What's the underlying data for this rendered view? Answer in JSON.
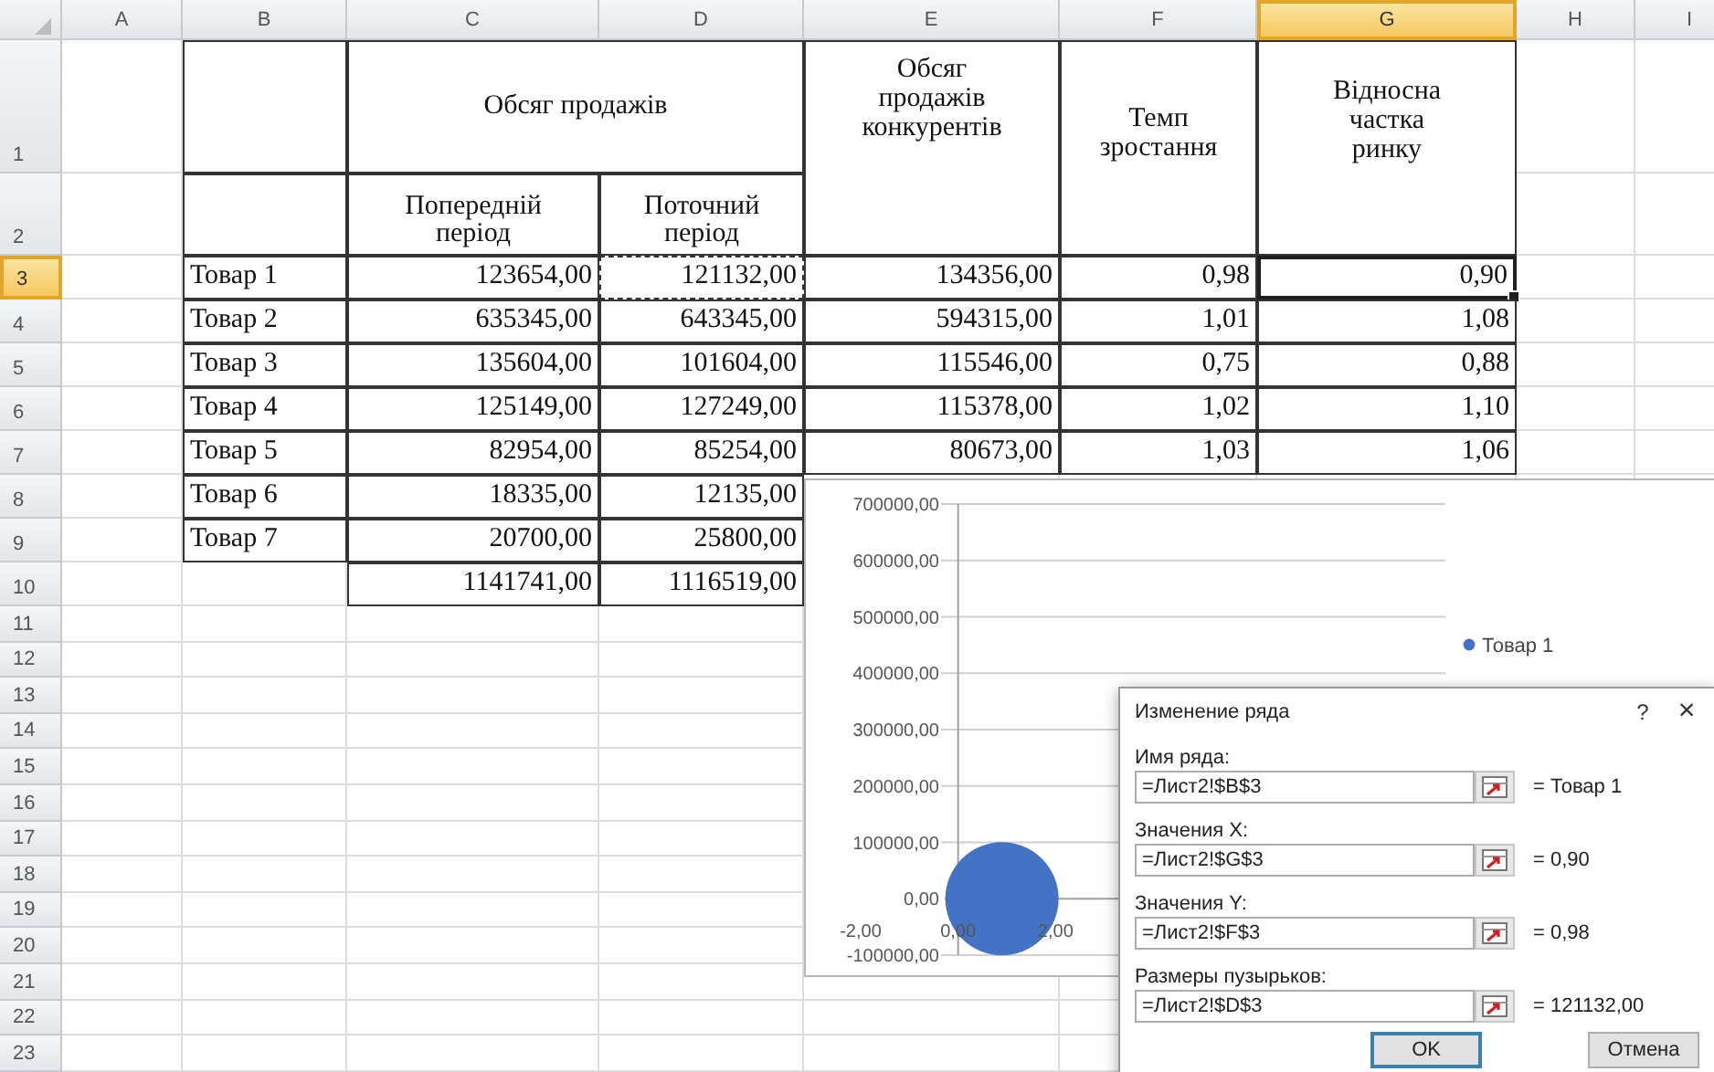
{
  "columns": [
    {
      "label": "A",
      "selected": false
    },
    {
      "label": "B",
      "selected": false
    },
    {
      "label": "C",
      "selected": false
    },
    {
      "label": "D",
      "selected": false
    },
    {
      "label": "E",
      "selected": false
    },
    {
      "label": "F",
      "selected": false
    },
    {
      "label": "G",
      "selected": true
    },
    {
      "label": "H",
      "selected": false
    },
    {
      "label": "I",
      "selected": false
    }
  ],
  "rows": [
    {
      "label": "1",
      "selected": false
    },
    {
      "label": "2",
      "selected": false
    },
    {
      "label": "3",
      "selected": true
    },
    {
      "label": "4",
      "selected": false
    },
    {
      "label": "5",
      "selected": false
    },
    {
      "label": "6",
      "selected": false
    },
    {
      "label": "7",
      "selected": false
    },
    {
      "label": "8",
      "selected": false
    },
    {
      "label": "9",
      "selected": false
    },
    {
      "label": "10",
      "selected": false
    },
    {
      "label": "11",
      "selected": false
    },
    {
      "label": "12",
      "selected": false
    },
    {
      "label": "13",
      "selected": false
    },
    {
      "label": "14",
      "selected": false
    },
    {
      "label": "15",
      "selected": false
    },
    {
      "label": "16",
      "selected": false
    },
    {
      "label": "17",
      "selected": false
    },
    {
      "label": "18",
      "selected": false
    },
    {
      "label": "19",
      "selected": false
    },
    {
      "label": "20",
      "selected": false
    },
    {
      "label": "21",
      "selected": false
    },
    {
      "label": "22",
      "selected": false
    },
    {
      "label": "23",
      "selected": false
    }
  ],
  "table": {
    "sales_header": "Обсяг продажів",
    "previous_header": "Попередній період",
    "current_header": "Поточний період",
    "competitors_header": "Обсяг продажів конкурентів",
    "growth_header": "Темп зростання",
    "share_header": "Відносна частка ринку",
    "products": [
      {
        "name": "Товар 1",
        "previous": "123654,00",
        "current": "121132,00",
        "competitors": "134356,00",
        "growth": "0,98",
        "share": "0,90",
        "current_copied": true,
        "share_selected": true
      },
      {
        "name": "Товар 2",
        "previous": "635345,00",
        "current": "643345,00",
        "competitors": "594315,00",
        "growth": "1,01",
        "share": "1,08",
        "current_copied": false,
        "share_selected": false
      },
      {
        "name": "Товар 3",
        "previous": "135604,00",
        "current": "101604,00",
        "competitors": "115546,00",
        "growth": "0,75",
        "share": "0,88",
        "current_copied": false,
        "share_selected": false
      },
      {
        "name": "Товар 4",
        "previous": "125149,00",
        "current": "127249,00",
        "competitors": "115378,00",
        "growth": "1,02",
        "share": "1,10",
        "current_copied": false,
        "share_selected": false
      },
      {
        "name": "Товар 5",
        "previous": "82954,00",
        "current": "85254,00",
        "competitors": "80673,00",
        "growth": "1,03",
        "share": "1,06",
        "current_copied": false,
        "share_selected": false
      },
      {
        "name": "Товар 6",
        "previous": "18335,00",
        "current": "12135,00",
        "current_copied": false
      },
      {
        "name": "Товар 7",
        "previous": "20700,00",
        "current": "25800,00",
        "current_copied": false
      }
    ],
    "totals": {
      "previous": "1141741,00",
      "current": "1116519,00"
    }
  },
  "chart": {
    "chart_data": {
      "type": "scatter",
      "x": [
        0.9
      ],
      "series": [
        {
          "name": "Товар 1",
          "color": "#4472c4",
          "values": [
            0.98
          ]
        }
      ],
      "ylim": [
        -100000,
        700000
      ],
      "xlim": [
        -2,
        10
      ],
      "grid": true,
      "xticks": [
        {
          "value": -2,
          "label": "-2,00"
        },
        {
          "value": 0,
          "label": "0,00"
        },
        {
          "value": 2,
          "label": "2,00"
        }
      ],
      "yticks": [
        {
          "value": 700000,
          "label": "700000,00"
        },
        {
          "value": 600000,
          "label": "600000,00"
        },
        {
          "value": 500000,
          "label": "500000,00"
        },
        {
          "value": 400000,
          "label": "400000,00"
        },
        {
          "value": 300000,
          "label": "300000,00"
        },
        {
          "value": 200000,
          "label": "200000,00"
        },
        {
          "value": 100000,
          "label": "100000,00"
        },
        {
          "value": 0,
          "label": "0,00"
        },
        {
          "value": -100000,
          "label": "-100000,00"
        }
      ]
    }
  },
  "dialog": {
    "title": "Изменение ряда",
    "help": "?",
    "close": "×",
    "fields": [
      {
        "label": "Имя ряда:",
        "value": "=Лист2!$B$3",
        "result": "= Товар 1"
      },
      {
        "label": "Значения X:",
        "value": "=Лист2!$G$3",
        "result": "= 0,90"
      },
      {
        "label": "Значения Y:",
        "value": "=Лист2!$F$3",
        "result": "= 0,98"
      },
      {
        "label": "Размеры пузырьков:",
        "value": "=Лист2!$D$3",
        "result": "= 121132,00"
      }
    ],
    "buttons": [
      {
        "label": "OK",
        "default": true
      },
      {
        "label": "Отмена",
        "default": false
      }
    ]
  }
}
